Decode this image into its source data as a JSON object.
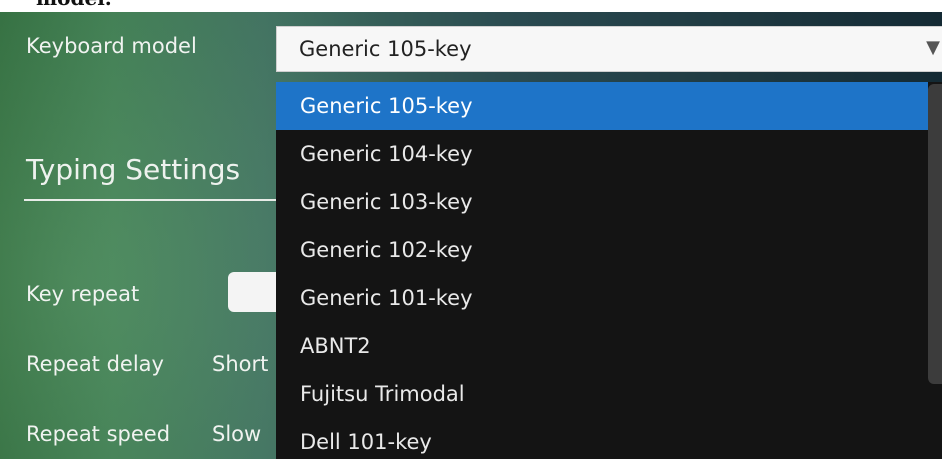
{
  "top_partial_text": "model.",
  "keyboard_model": {
    "label": "Keyboard model",
    "selected": "Generic 105-key",
    "arrow_icon": "triangle-down-icon"
  },
  "typing": {
    "title": "Typing Settings",
    "key_repeat_label": "Key repeat",
    "repeat_delay_label": "Repeat delay",
    "repeat_delay_min": "Short",
    "repeat_speed_label": "Repeat speed",
    "repeat_speed_min": "Slow"
  },
  "dropdown": {
    "options": [
      "Generic 105-key",
      "Generic 104-key",
      "Generic 103-key",
      "Generic 102-key",
      "Generic 101-key",
      "ABNT2",
      "Fujitsu Trimodal",
      "Dell 101-key"
    ],
    "highlighted": "Generic 105-key"
  },
  "colors": {
    "highlight": "#1e74c8",
    "dropdown_bg": "#141414"
  }
}
